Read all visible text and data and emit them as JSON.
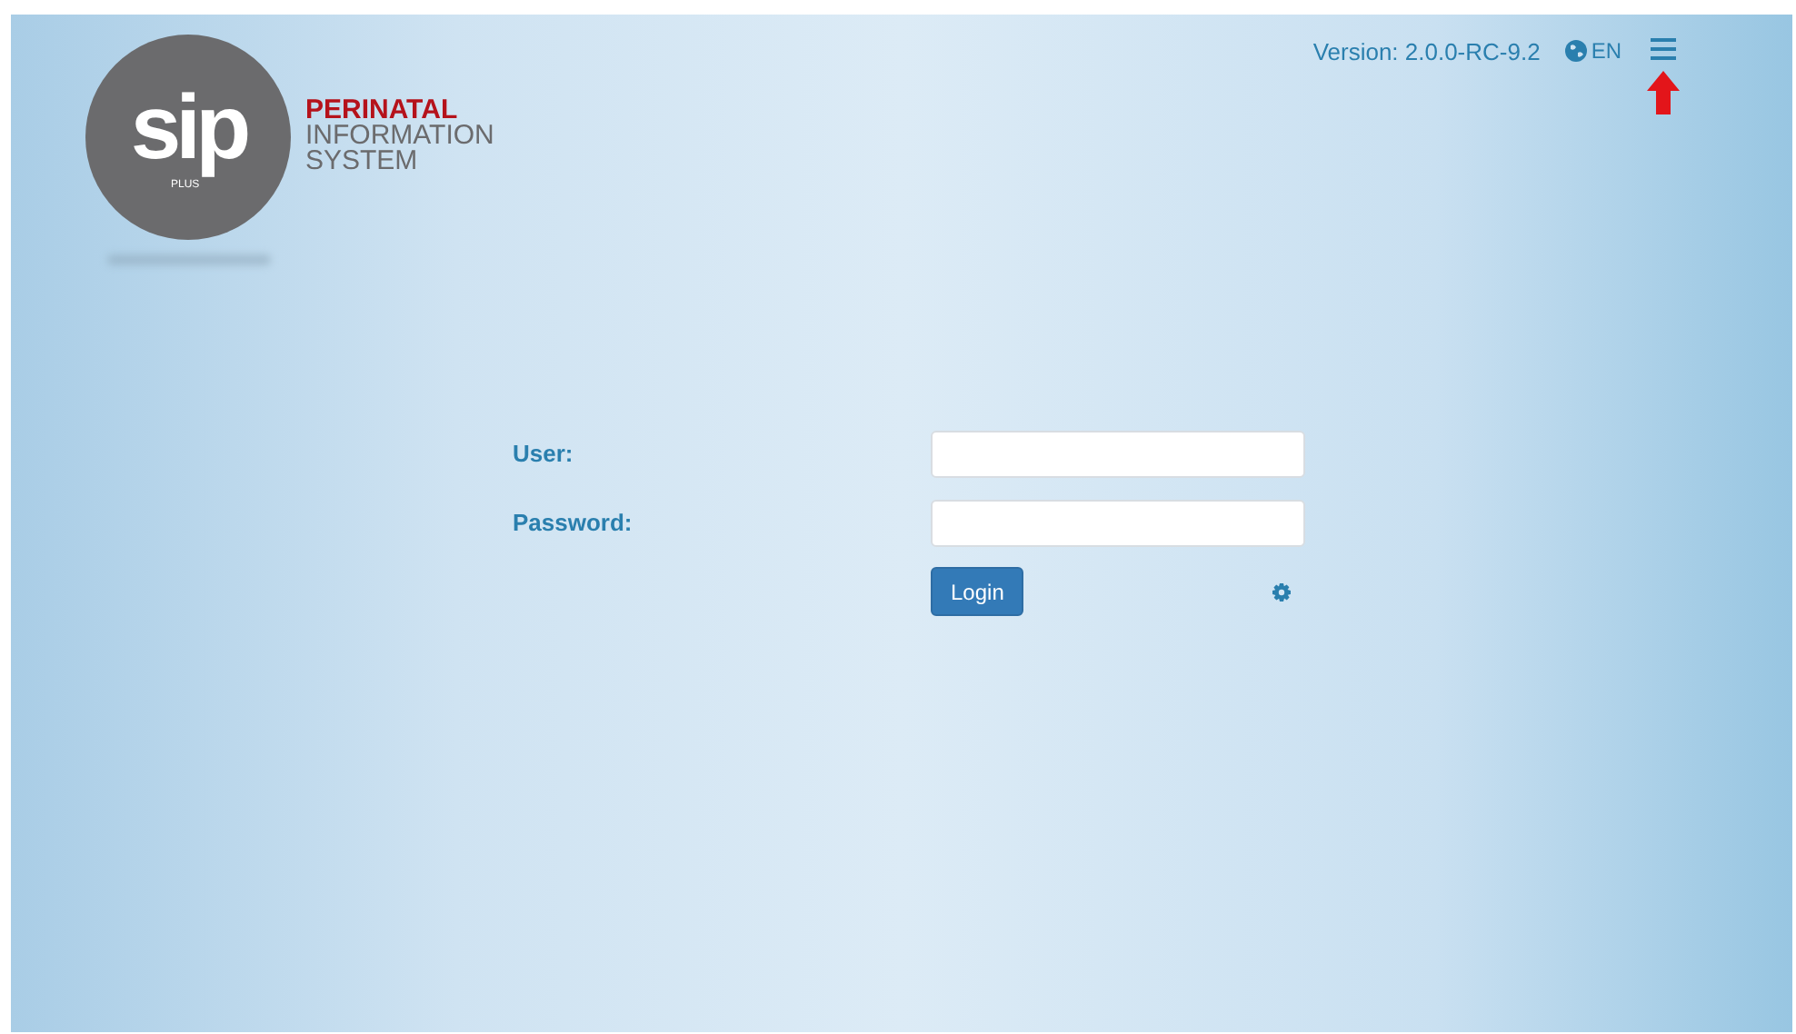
{
  "logo": {
    "mark": "sip",
    "sub": "PLUS",
    "title": [
      "PERINATAL",
      "INFORMATION",
      "SYSTEM"
    ]
  },
  "header": {
    "version": "Version: 2.0.0-RC-9.2",
    "language": "EN"
  },
  "form": {
    "fields": [
      {
        "label": "User:"
      },
      {
        "label": "Password:"
      }
    ],
    "submit": "Login"
  }
}
